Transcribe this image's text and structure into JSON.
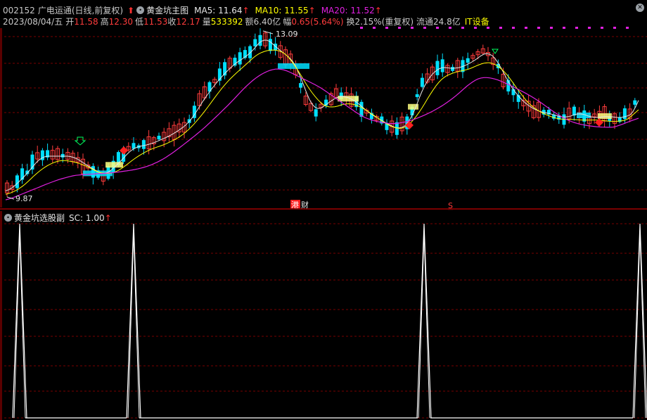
{
  "header": {
    "code": "002152",
    "name": "广电运通",
    "period": "(日线,前复权)",
    "indicator": "黄金坑主图",
    "ma5": "MA5: 11.64",
    "ma10": "MA10: 11.55",
    "ma20": "MA20: 11.52",
    "date": "2023/08/04/五",
    "open_label": "开",
    "open": "11.58",
    "high_label": "高",
    "high": "12.30",
    "low_label": "低",
    "low": "11.53",
    "close_label": "收",
    "close": "12.17",
    "vol_label": "量",
    "vol": "533392",
    "amount_label": "额",
    "amount": "6.40亿",
    "change_label": "幅",
    "change": "0.65(5.64%)",
    "turnover": "换2.15%(重复权)",
    "float": "流通24.8亿",
    "sector": "IT设备"
  },
  "chart_labels": {
    "high_mark": "13.09",
    "low_mark": "9.87",
    "hk_tag": "港",
    "cai_tag": "财",
    "s_tag": "S"
  },
  "sub_panel": {
    "title": "黄金坑选股副",
    "sc": "SC: 1.00"
  },
  "colors": {
    "up": "#ff3c3c",
    "down": "#00e0ff",
    "ma5": "#e6e6e6",
    "ma10": "#ffff00",
    "ma20": "#e020e0",
    "grid": "#7a0000"
  }
}
